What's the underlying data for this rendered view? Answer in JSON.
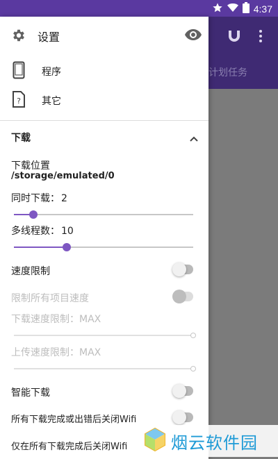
{
  "status_bar": {
    "time": "4:37",
    "icons": [
      "star-icon",
      "wifi-icon",
      "battery-icon"
    ]
  },
  "background": {
    "toolbar_partial_text": "计划任务",
    "icons": [
      "magnet-icon",
      "more-vert-icon"
    ]
  },
  "drawer": {
    "header": {
      "title": "设置",
      "left_icon": "gear-icon",
      "right_icon": "eye-icon"
    },
    "nav_items": [
      {
        "label": "程序",
        "icon": "phone-icon"
      },
      {
        "label": "其它",
        "icon": "unknown-file-icon"
      }
    ],
    "download_section": {
      "title": "下载",
      "location_label": "下载位置",
      "location_value": "/storage/emulated/0",
      "concurrent_label": "同时下载：",
      "concurrent_value": "2",
      "concurrent_fraction": 0.11,
      "threads_label": "多线程数：",
      "threads_value": "10",
      "threads_fraction": 0.295,
      "speed_limit_label": "速度限制",
      "speed_limit_on": false,
      "limit_all_label": "限制所有项目速度",
      "limit_all_on": false,
      "download_speed_label": "下载速度限制：",
      "download_speed_value": "MAX",
      "upload_speed_label": "上传速度限制：",
      "upload_speed_value": "MAX",
      "smart_download_label": "智能下载",
      "smart_download_on": false,
      "close_wifi_all_label": "所有下载完成或出错后关闭Wifi",
      "close_wifi_all_on": false,
      "close_wifi_only_label": "仅在所有下载完成后关闭Wifi"
    }
  },
  "watermark": {
    "text": "烟云软件园"
  },
  "colors": {
    "status_bar": "#5a39a0",
    "toolbar": "#3f2a73",
    "accent": "#7e57c2",
    "scrim": "#7b7b7b"
  }
}
